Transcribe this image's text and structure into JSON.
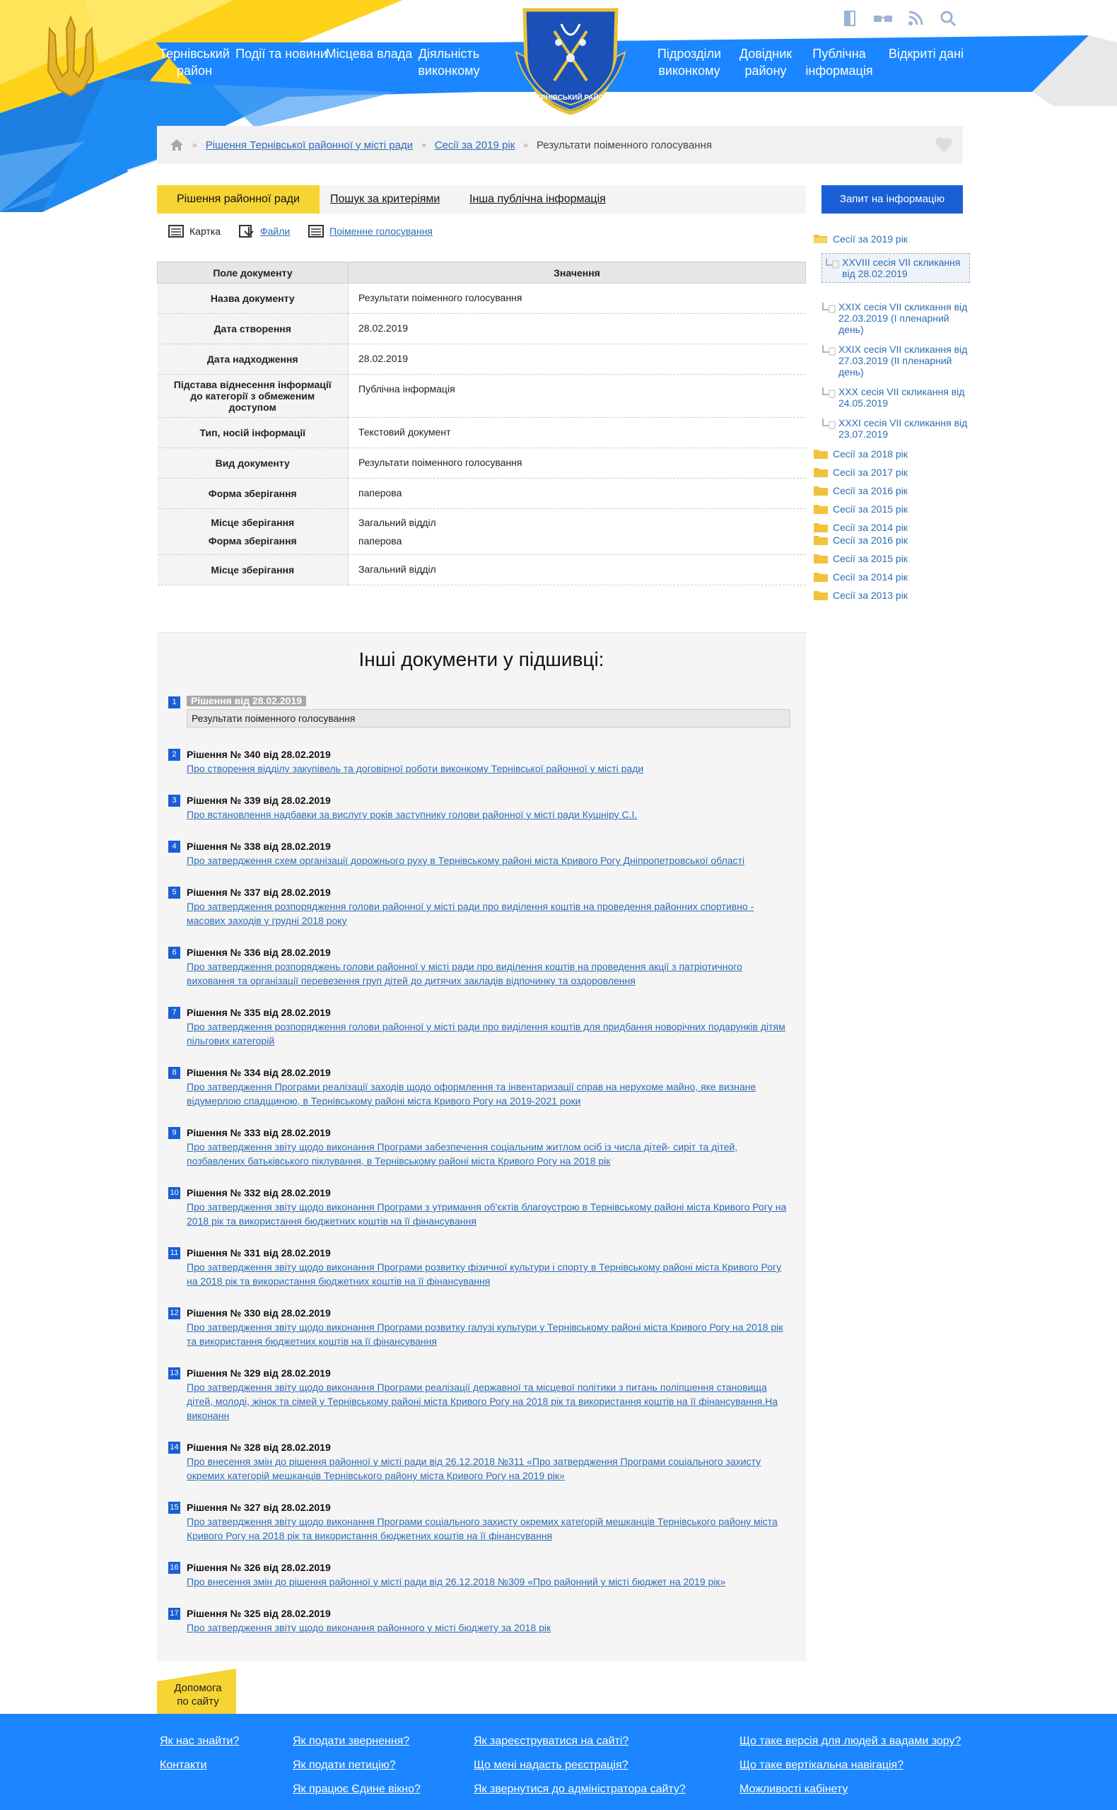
{
  "colors": {
    "accent_blue": "#1b86ff",
    "brand_blue": "#1a5fd6",
    "yellow": "#f5d434",
    "link": "#2d6cb5"
  },
  "header": {
    "nav": [
      "Тернівський район",
      "Події та новини",
      "Місцева влада",
      "Діяльність виконкому",
      "Підрозділи виконкому",
      "Довідник району",
      "Публічна інформація",
      "Відкриті дані"
    ],
    "emblem_text": "ТЕРНІВСЬКИЙ РАЙОН",
    "icons": [
      "door-icon",
      "glasses-icon",
      "rss-icon",
      "search-icon"
    ]
  },
  "breadcrumb": {
    "items": [
      "Рішення Тернівської районної у місті ради",
      "Сесії за 2019 рік"
    ],
    "current": "Результати поіменного голосування"
  },
  "tabs": [
    "Рішення районної ради",
    "Пошук за критеріями",
    "Інша публічна інформація"
  ],
  "request_button": "Запит на інформацію",
  "subtabs": [
    "Картка",
    "Файли",
    "Поіменне голосування"
  ],
  "doc_table": {
    "headers": [
      "Поле документу",
      "Значення"
    ],
    "rows": [
      [
        "Назва документу",
        "Результати поіменного голосування"
      ],
      [
        "Дата створення",
        "28.02.2019"
      ],
      [
        "Дата надходження",
        "28.02.2019"
      ],
      [
        "Підстава віднесення інформації до категорії з обмеженим доступом",
        "Публічна інформація"
      ],
      [
        "Тип, носій інформації",
        "Текстовий документ"
      ],
      [
        "Вид документу",
        "Результати поіменного голосування"
      ],
      [
        "Форма зберігання",
        "паперова"
      ],
      [
        "Місце зберігання",
        "Загальний відділ"
      ],
      [
        "Форма зберігання",
        "паперова"
      ],
      [
        "Місце зберігання",
        "Загальний відділ"
      ]
    ]
  },
  "tree": {
    "open_folder": "Сесії за 2019 рік",
    "children": [
      "XXVIII сесія VII скликання від 28.02.2019",
      "XXIX сесія VII скликання від 22.03.2019 (І пленарний день)",
      "XXIX сесія VII скликання від 27.03.2019 (ІІ пленарний день)",
      "XXX сесія VII скликання від 24.05.2019",
      "XXXI сесія VII скликання від 23.07.2019"
    ],
    "folders": [
      "Сесії за 2018 рік",
      "Сесії за 2017 рік",
      "Сесії за 2016 рік",
      "Сесії за 2015 рік",
      "Сесії за 2014 рік",
      "Сесії за 2016 рік",
      "Сесії за 2015 рік",
      "Сесії за 2014 рік",
      "Сесії за 2013 рік"
    ]
  },
  "others": {
    "title": "Інші документи у підшивці:",
    "first": {
      "num": "1",
      "head": "Рішення від 28.02.2019",
      "title": "Результати поіменного голосування"
    },
    "items": [
      {
        "num": "2",
        "head": "Рішення № 340 від 28.02.2019",
        "title": "Про створення відділу закупівель та договірної роботи виконкому Тернівської районної у місті ради"
      },
      {
        "num": "3",
        "head": "Рішення № 339 від 28.02.2019",
        "title": "Про встановлення надбавки за вислугу років заступнику голови районної у місті ради Кушніру С.І."
      },
      {
        "num": "4",
        "head": "Рішення № 338 від 28.02.2019",
        "title": "Про затвердження схем організації дорожнього руху в Тернівському районі міста Кривого Рогу Дніпропетровської області"
      },
      {
        "num": "5",
        "head": "Рішення № 337 від 28.02.2019",
        "title": "Про затвердження розпорядження голови районної у місті ради про виділення коштів на проведення районних спортивно - масових заходів у грудні 2018 року"
      },
      {
        "num": "6",
        "head": "Рішення № 336 від 28.02.2019",
        "title": "Про затвердження розпоряджень голови районної у місті ради про виділення коштів на проведення акції з патріотичного виховання та організації перевезення груп дітей до дитячих закладів відпочинку та оздоровлення"
      },
      {
        "num": "7",
        "head": "Рішення № 335 від 28.02.2019",
        "title": "Про затвердження розпорядження голови районної у місті ради про виділення коштів для придбання новорічних подарунків дітям пільгових категорій"
      },
      {
        "num": "8",
        "head": "Рішення № 334 від 28.02.2019",
        "title": "Про затвердження Програми реалізації заходів щодо оформлення та інвентаризації справ на нерухоме майно, яке визнане відумерлою спадщиною, в Тернівському районі міста Кривого Рогу на 2019-2021 роки"
      },
      {
        "num": "9",
        "head": "Рішення № 333 від 28.02.2019",
        "title": "Про затвердження звіту щодо виконання Програми забезпечення соціальним житлом осіб із числа дітей- сиріт та дітей, позбавлених батьківського піклування, в Тернівському районі міста Кривого Рогу на 2018 рік"
      },
      {
        "num": "10",
        "head": "Рішення № 332 від 28.02.2019",
        "title": "Про затвердження звіту щодо виконання Програми з утримання об'єктів благоустрою в Тернівському районі міста Кривого Рогу на 2018 рік та використання бюджетних коштів на її фінансування"
      },
      {
        "num": "11",
        "head": "Рішення № 331 від 28.02.2019",
        "title": "Про затвердження звіту щодо виконання Програми розвитку фізичної культури і спорту в Тернівському районі міста Кривого Рогу на 2018 рік та використання бюджетних коштів на її фінансування"
      },
      {
        "num": "12",
        "head": "Рішення № 330 від 28.02.2019",
        "title": "Про затвердження звіту щодо виконання Програми розвитку галузі культури у Тернівському районі міста Кривого Рогу на 2018 рік та використання бюджетних коштів на її фінансування"
      },
      {
        "num": "13",
        "head": "Рішення № 329 від 28.02.2019",
        "title": "Про затвердження звіту щодо виконання Програми реалізації державної та місцевої політики з питань поліпшення становища дітей, молоді, жінок та сімей у Тернівському районі міста Кривого Рогу на 2018 рік та використання коштів на її фінансування.На виконанн"
      },
      {
        "num": "14",
        "head": "Рішення № 328 від 28.02.2019",
        "title": "Про внесення змін до рішення районної у місті ради від 26.12.2018 №311 «Про затвердження Програми соціального захисту окремих категорій мешканців Тернівського району міста Кривого Рогу на 2019 рік»"
      },
      {
        "num": "15",
        "head": "Рішення № 327 від 28.02.2019",
        "title": "Про затвердження звіту щодо виконання Програми соціального захисту окремих категорій мешканців Тернівського району міста Кривого Рогу на 2018 рік та використання бюджетних коштів на її фінансування"
      },
      {
        "num": "16",
        "head": "Рішення № 326 від 28.02.2019",
        "title": "Про внесення змін до рішення районної у місті ради від 26.12.2018 №309 «Про районний у місті бюджет на 2019 рік»"
      },
      {
        "num": "17",
        "head": "Рішення № 325 від 28.02.2019",
        "title": "Про затвердження звіту щодо виконання районного у місті бюджету за 2018 рік"
      }
    ]
  },
  "help": "Допомога по сайту",
  "footer": {
    "col1": [
      "Як нас знайти?",
      "Контакти"
    ],
    "col2": [
      "Як подати звернення?",
      "Як подати петицію?",
      "Як працює Єдине вікно?"
    ],
    "col3": [
      "Як зареєструватися на сайті?",
      "Що мені надасть реєстрація?",
      "Як звернутися до адміністратора сайту?"
    ],
    "col4": [
      "Що таке версія для людей з вадами зору?",
      "Що таке вертікальна навігація?",
      "Можливості кабінету"
    ]
  }
}
